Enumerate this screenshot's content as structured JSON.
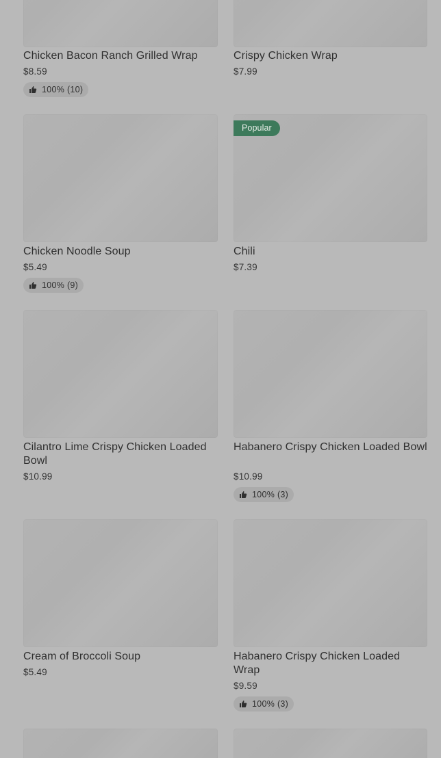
{
  "menu_items": [
    {
      "name": "Chicken Bacon Ranch Grilled Wrap",
      "price": "$8.59",
      "rating": "100% (10)"
    },
    {
      "name": "Crispy Chicken Wrap",
      "price": "$7.99"
    },
    {
      "name": "Chicken Noodle Soup",
      "price": "$5.49",
      "rating": "100% (9)"
    },
    {
      "name": "Chili",
      "price": "$7.39",
      "badge": "Popular"
    },
    {
      "name": "Cilantro Lime Crispy Chicken Loaded Bowl",
      "price": "$10.99"
    },
    {
      "name": "Habanero Crispy Chicken Loaded Bowl",
      "price": "$10.99",
      "rating": "100% (3)"
    },
    {
      "name": "Cream of Broccoli Soup",
      "price": "$5.49"
    },
    {
      "name": "Habanero Crispy Chicken Loaded Wrap",
      "price": "$9.59",
      "rating": "100% (3)"
    }
  ],
  "colors": {
    "overlay_background": "#b9b9b9",
    "popular_badge": "#3d7a5b",
    "rating_pill": "#ababab"
  },
  "icons": {
    "rating": "thumbs-up-icon"
  }
}
